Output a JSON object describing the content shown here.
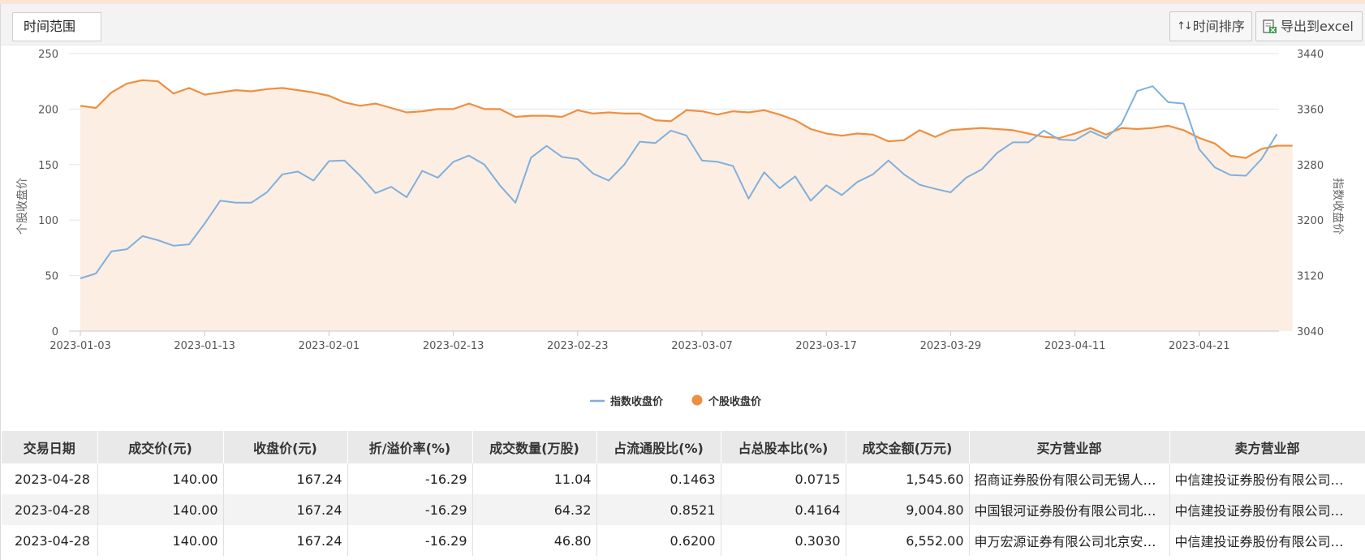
{
  "toolbar": {
    "time_range_label": "时间范围",
    "sort_label": "时间排序",
    "sort_icon": "↑↓",
    "export_label": "导出到excel"
  },
  "colors": {
    "index_line": "#7fb0dc",
    "stock_line": "#ee8f3f",
    "stock_area": "#fdeee3",
    "grid": "#e5e5e5",
    "accent": "#fbe5d6"
  },
  "chart_data": {
    "type": "line",
    "xlabel": "",
    "ylabel_left": "个股收盘价",
    "ylabel_right": "指数收盘价",
    "ylim_left": [
      0,
      250
    ],
    "ylim_right": [
      3040,
      3440
    ],
    "yticks_left": [
      "0",
      "50",
      "100",
      "150",
      "200",
      "250"
    ],
    "yticks_right": [
      "3040",
      "3120",
      "3200",
      "3280",
      "3360",
      "3440"
    ],
    "xticks": [
      "2023-01-03",
      "2023-01-13",
      "2023-02-01",
      "2023-02-13",
      "2023-02-23",
      "2023-03-07",
      "2023-03-17",
      "2023-03-29",
      "2023-04-11",
      "2023-04-21"
    ],
    "legend_position": "bottom",
    "series": [
      {
        "name": "指数收盘价",
        "axis": "right",
        "values": [
          3116,
          3123,
          3155,
          3158,
          3177,
          3171,
          3163,
          3165,
          3195,
          3228,
          3225,
          3225,
          3240,
          3266,
          3270,
          3257,
          3285,
          3286,
          3264,
          3239,
          3248,
          3233,
          3271,
          3261,
          3284,
          3293,
          3280,
          3250,
          3225,
          3290,
          3307,
          3291,
          3288,
          3267,
          3257,
          3280,
          3313,
          3311,
          3329,
          3322,
          3286,
          3284,
          3278,
          3231,
          3269,
          3246,
          3263,
          3228,
          3250,
          3236,
          3255,
          3266,
          3286,
          3266,
          3251,
          3245,
          3240,
          3261,
          3273,
          3297,
          3312,
          3312,
          3329,
          3316,
          3315,
          3328,
          3318,
          3339,
          3386,
          3393,
          3370,
          3368,
          3302,
          3276,
          3265,
          3264,
          3288,
          3324
        ]
      },
      {
        "name": "个股收盘价",
        "axis": "left",
        "values": [
          203,
          201,
          215,
          223,
          226,
          225,
          214,
          219,
          213,
          215,
          217,
          216,
          218,
          219,
          217,
          215,
          212,
          206,
          203,
          205,
          201,
          197,
          198,
          200,
          200,
          205,
          200,
          200,
          193,
          194,
          194,
          193,
          199,
          196,
          197,
          196,
          196,
          190,
          189,
          199,
          198,
          195,
          198,
          197,
          199,
          195,
          190,
          182,
          178,
          176,
          178,
          177,
          171,
          172,
          181,
          175,
          181,
          182,
          183,
          182,
          181,
          178,
          175,
          174,
          178,
          183,
          177,
          183,
          182,
          183,
          185,
          181,
          174,
          169,
          158,
          156,
          164,
          167,
          167
        ]
      }
    ]
  },
  "table": {
    "headers": [
      "交易日期",
      "成交价(元)",
      "收盘价(元)",
      "折/溢价率(%)",
      "成交数量(万股)",
      "占流通股比(%)",
      "占总股本比(%)",
      "成交金额(万元)",
      "买方营业部",
      "卖方营业部"
    ],
    "rows": [
      [
        "2023-04-28",
        "140.00",
        "167.24",
        "-16.29",
        "11.04",
        "0.1463",
        "0.0715",
        "1,545.60",
        "招商证券股份有限公司无锡人…",
        "中信建投证券股份有限公司…"
      ],
      [
        "2023-04-28",
        "140.00",
        "167.24",
        "-16.29",
        "64.32",
        "0.8521",
        "0.4164",
        "9,004.80",
        "中国银河证券股份有限公司北…",
        "中信建投证券股份有限公司…"
      ],
      [
        "2023-04-28",
        "140.00",
        "167.24",
        "-16.29",
        "46.80",
        "0.6200",
        "0.3030",
        "6,552.00",
        "申万宏源证券有限公司北京安…",
        "中信建投证券股份有限公司…"
      ]
    ]
  }
}
